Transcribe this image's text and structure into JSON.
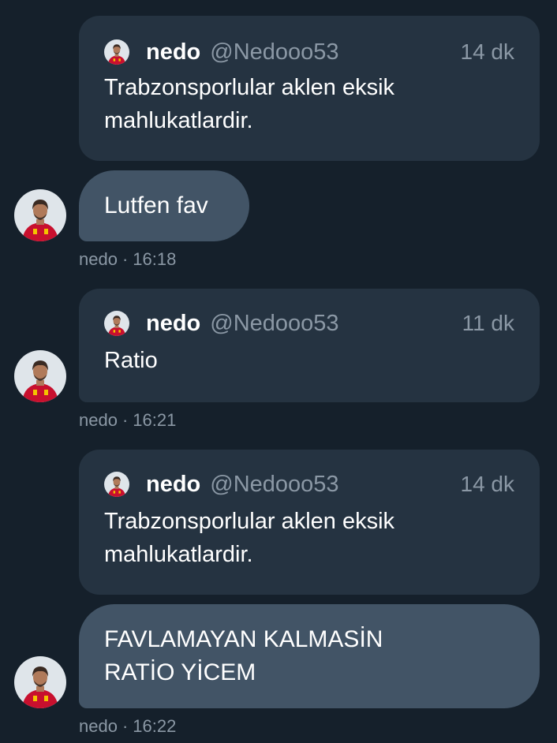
{
  "messages": [
    {
      "quote": {
        "name": "nedo",
        "handle": "@Nedooo53",
        "time": "14 dk",
        "text_lines": [
          "Trabzonsporlular aklen eksik",
          "mahlukatlardir."
        ]
      },
      "bubble_lines": [
        "Lutfen fav"
      ],
      "meta": {
        "name": "nedo",
        "time": "16:18"
      }
    },
    {
      "quote": {
        "name": "nedo",
        "handle": "@Nedooo53",
        "time": "11 dk",
        "text_lines": [
          "Ratio"
        ]
      },
      "meta": {
        "name": "nedo",
        "time": "16:21"
      }
    },
    {
      "quote": {
        "name": "nedo",
        "handle": "@Nedooo53",
        "time": "14 dk",
        "text_lines": [
          "Trabzonsporlular aklen eksik",
          "mahlukatlardir."
        ]
      },
      "bubble_lines": [
        "FAVLAMAYAN KALMASİN",
        "RATİO YİCEM"
      ],
      "meta": {
        "name": "nedo",
        "time": "16:22"
      }
    }
  ],
  "colors": {
    "background": "#15202b",
    "quote_card": "#253341",
    "bubble": "#425466",
    "muted_text": "#8b98a5",
    "avatar_jersey": "#c8102e"
  }
}
